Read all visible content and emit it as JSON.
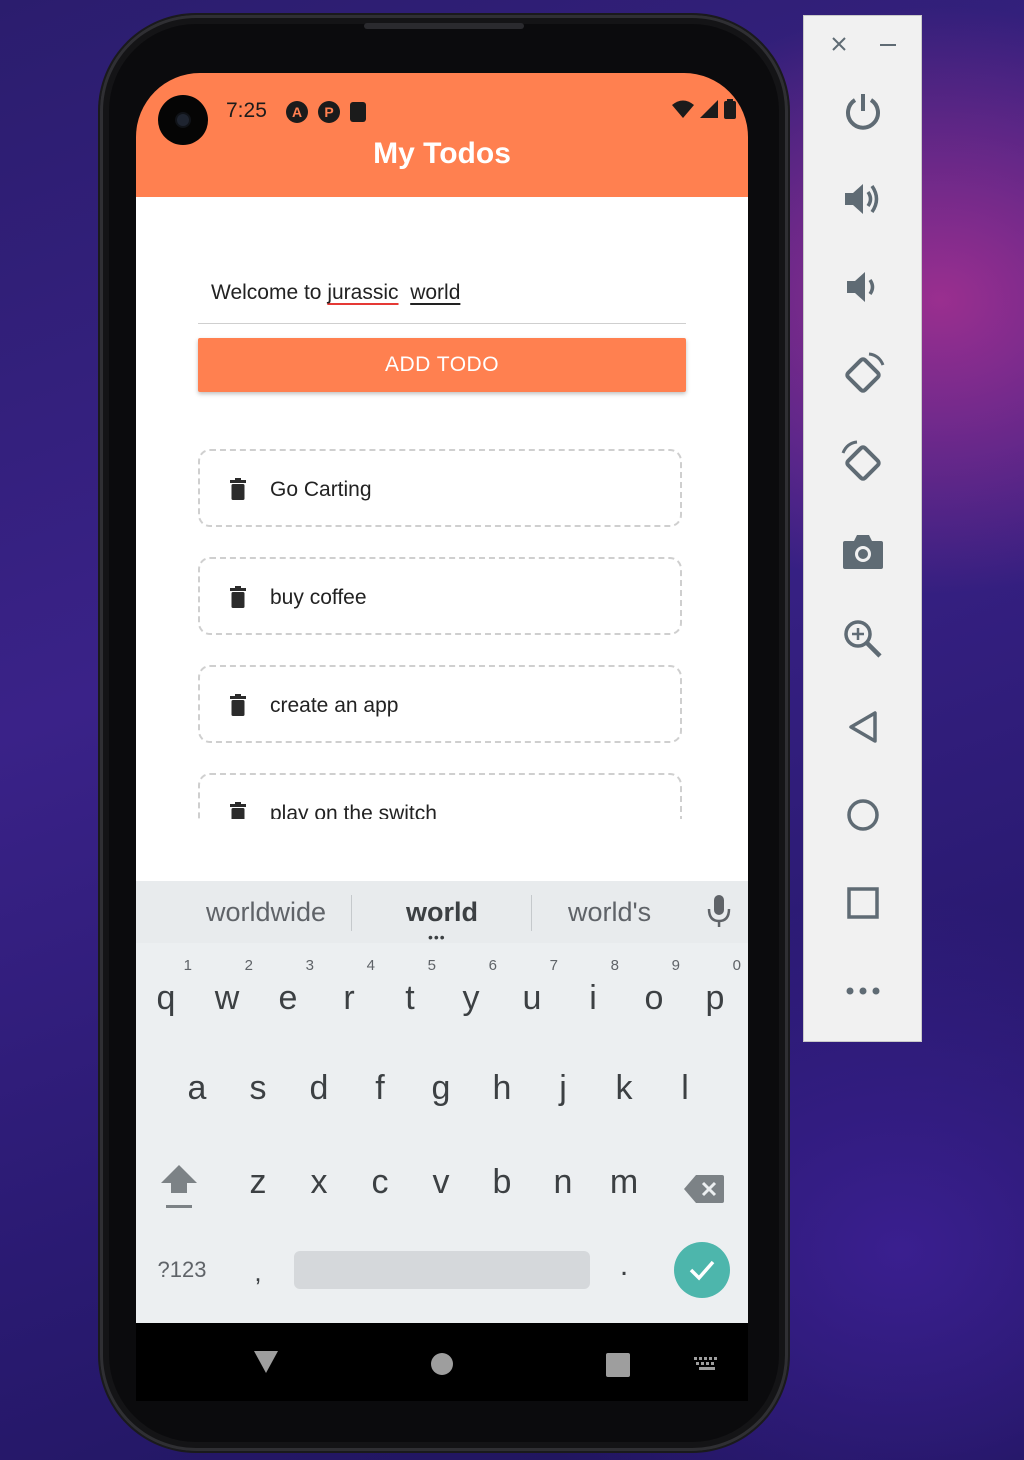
{
  "status_bar": {
    "time": "7:25"
  },
  "app": {
    "title": "My Todos",
    "input": {
      "value_before": "Welcome to ",
      "misspelled_word": "jurassic",
      "gap": " ",
      "composing_word": "world"
    },
    "add_button_label": "ADD TODO",
    "todos": [
      "Go Carting",
      "buy coffee",
      "create an app",
      "play on the switch"
    ]
  },
  "keyboard": {
    "suggestions": [
      "worldwide",
      "world",
      "world's"
    ],
    "row1": [
      {
        "key": "q",
        "hint": "1"
      },
      {
        "key": "w",
        "hint": "2"
      },
      {
        "key": "e",
        "hint": "3"
      },
      {
        "key": "r",
        "hint": "4"
      },
      {
        "key": "t",
        "hint": "5"
      },
      {
        "key": "y",
        "hint": "6"
      },
      {
        "key": "u",
        "hint": "7"
      },
      {
        "key": "i",
        "hint": "8"
      },
      {
        "key": "o",
        "hint": "9"
      },
      {
        "key": "p",
        "hint": "0"
      }
    ],
    "row2": [
      "a",
      "s",
      "d",
      "f",
      "g",
      "h",
      "j",
      "k",
      "l"
    ],
    "row3": [
      "z",
      "x",
      "c",
      "v",
      "b",
      "n",
      "m"
    ],
    "symbols_label": "?123",
    "comma": ",",
    "period": "."
  },
  "colors": {
    "accent": "#ff8050",
    "enter_key": "#4db6ac",
    "keyboard_bg": "#eceff1"
  },
  "side_panel": {
    "icons": [
      "close-icon",
      "minimize-icon",
      "power-icon",
      "volume-up-icon",
      "volume-down-icon",
      "rotate-left-icon",
      "rotate-right-icon",
      "camera-icon",
      "zoom-icon",
      "back-icon",
      "home-icon",
      "overview-icon",
      "more-icon"
    ]
  }
}
